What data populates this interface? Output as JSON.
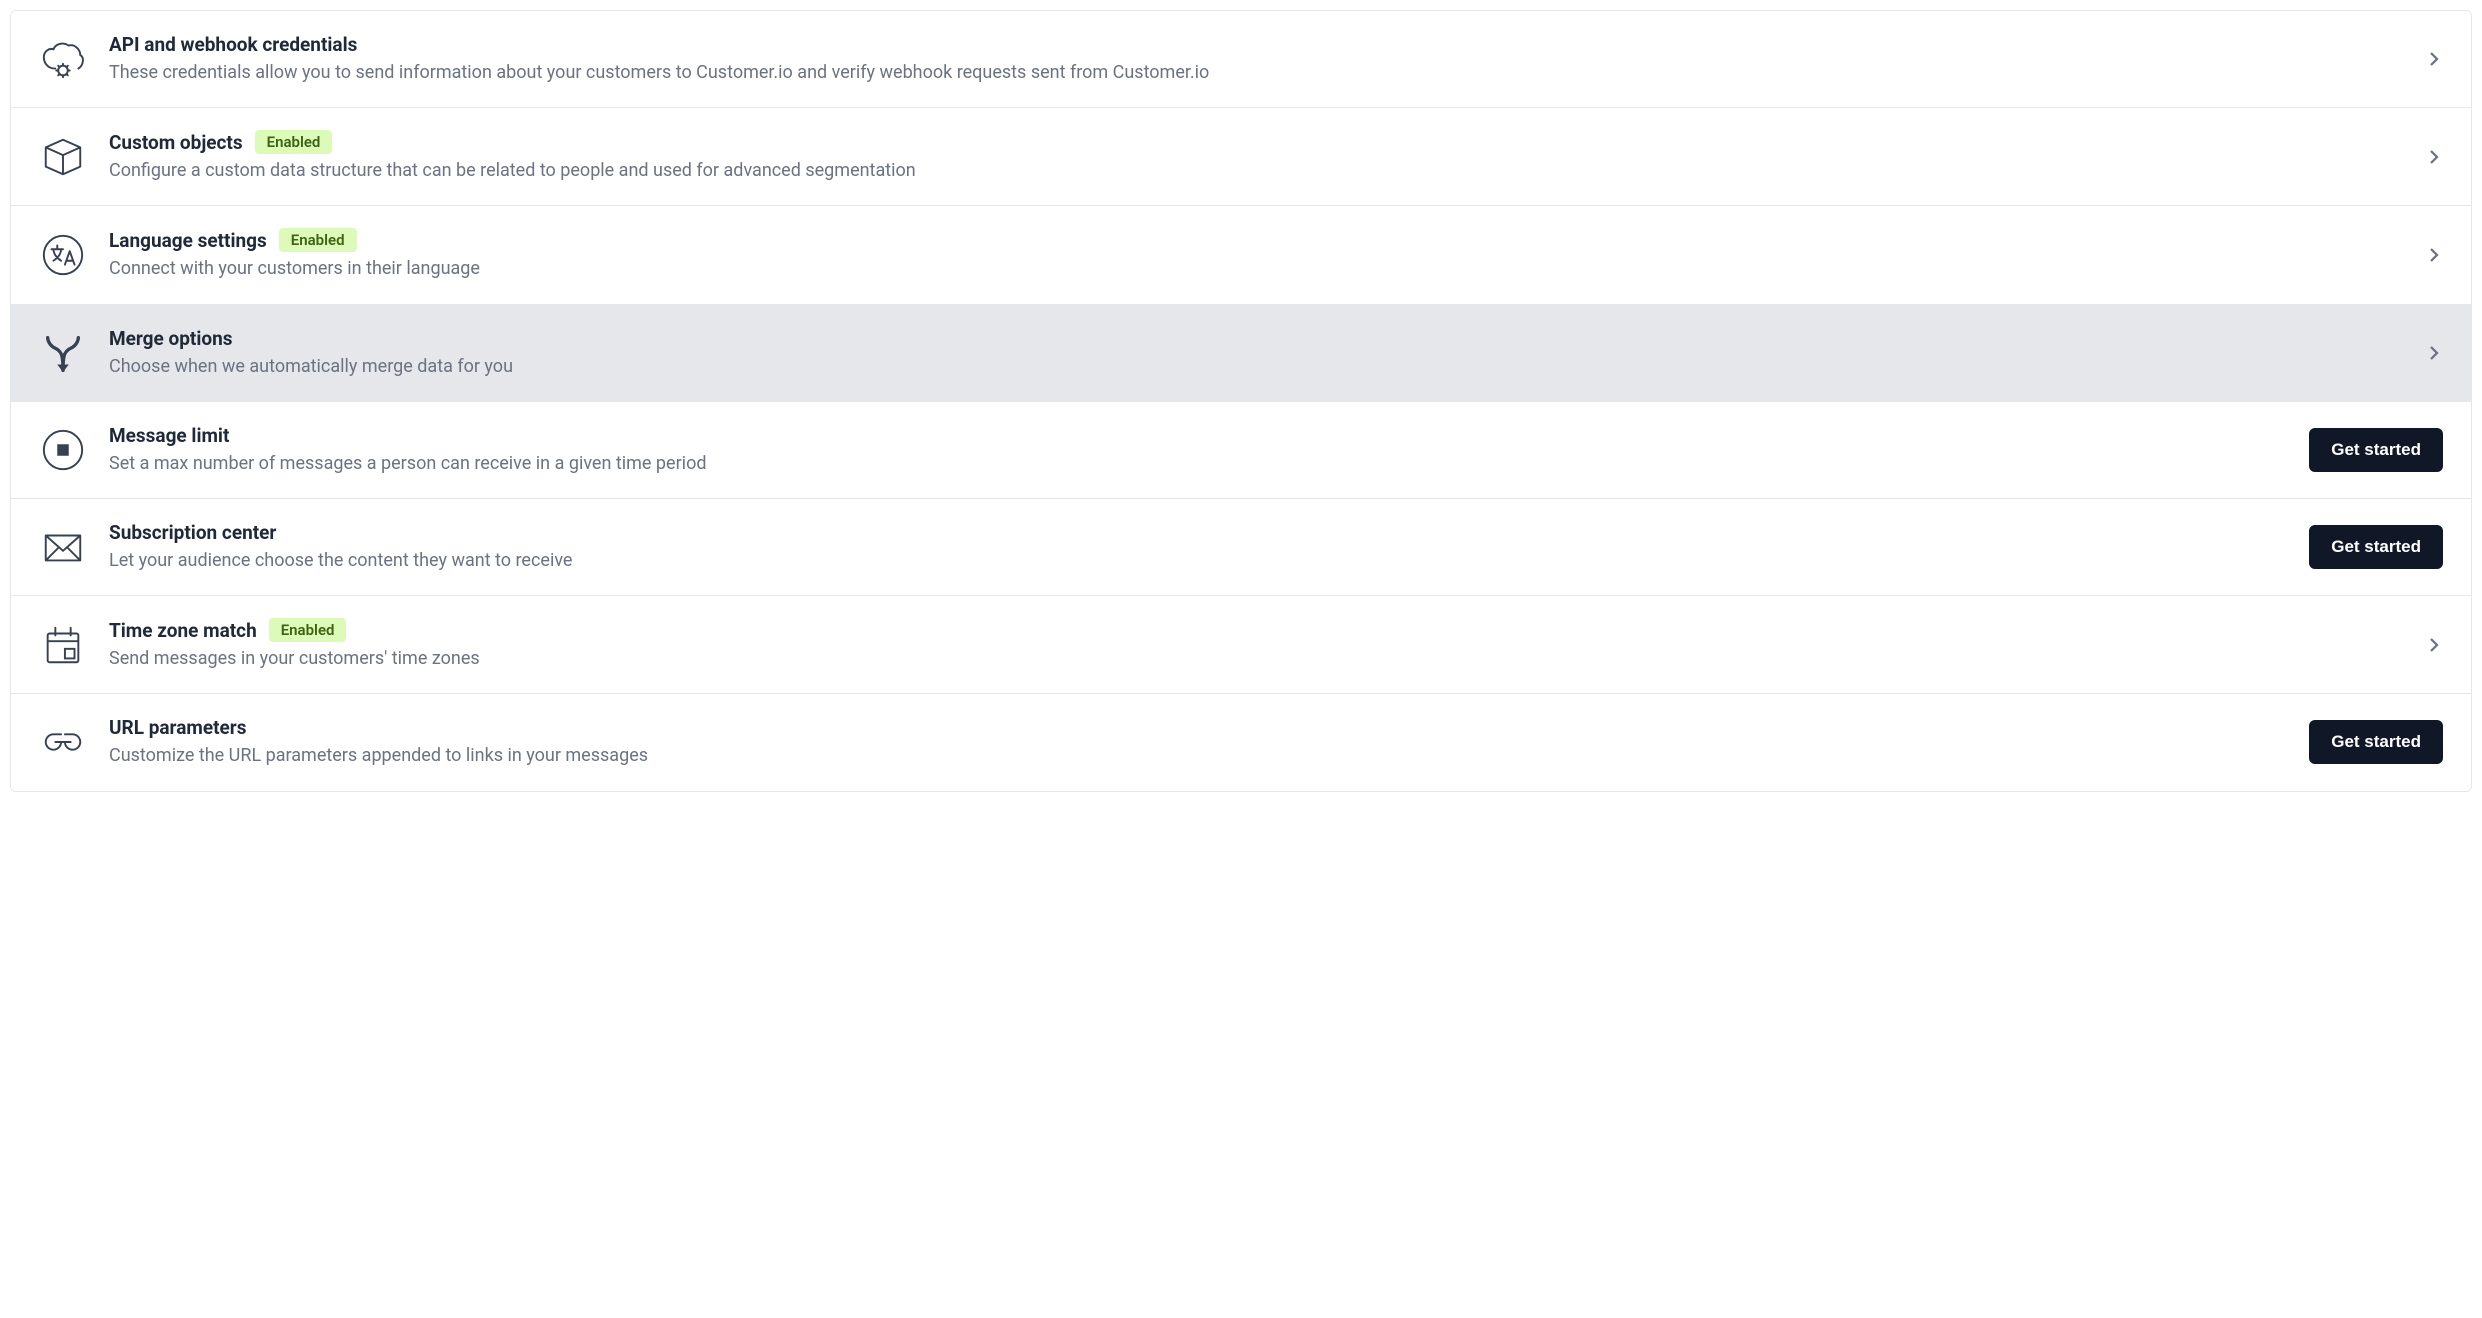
{
  "badge_label": "Enabled",
  "rows": [
    {
      "title": "API and webhook credentials",
      "desc": "These credentials allow you to send information about your customers to Customer.io and verify webhook requests sent from Customer.io",
      "badge": false,
      "action": "chevron",
      "highlight": false
    },
    {
      "title": "Custom objects",
      "desc": "Configure a custom data structure that can be related to people and used for advanced segmentation",
      "badge": true,
      "action": "chevron",
      "highlight": false
    },
    {
      "title": "Language settings",
      "desc": "Connect with your customers in their language",
      "badge": true,
      "action": "chevron",
      "highlight": false
    },
    {
      "title": "Merge options",
      "desc": "Choose when we automatically merge data for you",
      "badge": false,
      "action": "chevron",
      "highlight": true
    },
    {
      "title": "Message limit",
      "desc": "Set a max number of messages a person can receive in a given time period",
      "badge": false,
      "action": "button",
      "button_label": "Get started",
      "highlight": false
    },
    {
      "title": "Subscription center",
      "desc": "Let your audience choose the content they want to receive",
      "badge": false,
      "action": "button",
      "button_label": "Get started",
      "highlight": false
    },
    {
      "title": "Time zone match",
      "desc": "Send messages in your customers' time zones",
      "badge": true,
      "action": "chevron",
      "highlight": false
    },
    {
      "title": "URL parameters",
      "desc": "Customize the URL parameters appended to links in your messages",
      "badge": false,
      "action": "button",
      "button_label": "Get started",
      "highlight": false
    }
  ]
}
